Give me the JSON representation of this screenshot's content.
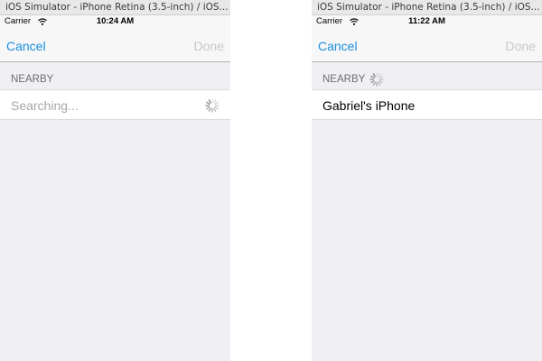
{
  "left_window": {
    "title": "iOS Simulator - iPhone Retina (3.5-inch) / iOS...",
    "status": {
      "carrier": "Carrier",
      "time": "10:24 AM"
    },
    "nav": {
      "cancel": "Cancel",
      "done": "Done"
    },
    "section_header": "NEARBY",
    "cell": {
      "text": "Searching..."
    }
  },
  "right_window": {
    "title": "iOS Simulator - iPhone Retina (3.5-inch) / iOS...",
    "status": {
      "carrier": "Carrier",
      "time": "11:22 AM"
    },
    "nav": {
      "cancel": "Cancel",
      "done": "Done"
    },
    "section_header": "NEARBY",
    "cell": {
      "text": "Gabriel's iPhone"
    }
  },
  "icons": {
    "wifi": "wifi-icon",
    "spinner": "activity-spinner-icon"
  },
  "colors": {
    "accent": "#1a8fe0",
    "disabled": "#c8c8cc",
    "background": "#efeff4",
    "placeholder": "#a6a6aa"
  }
}
